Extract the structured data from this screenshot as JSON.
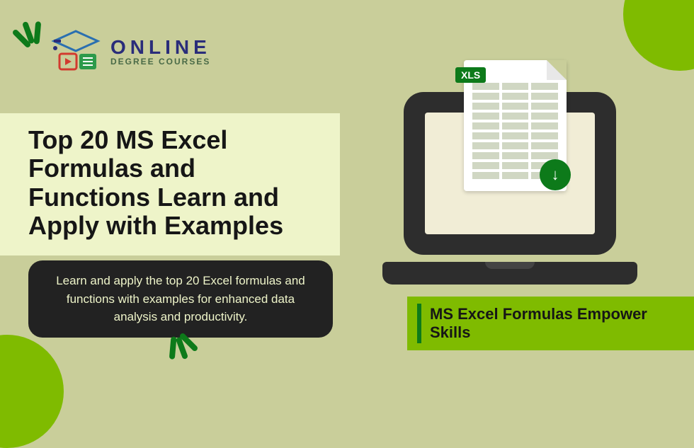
{
  "logo": {
    "main": "ONLINE",
    "sub": "DEGREE COURSES"
  },
  "title": "Top 20 MS Excel Formulas and Functions Learn and Apply with Examples",
  "description": "Learn and apply the top 20 Excel formulas and functions with examples for enhanced data analysis and productivity.",
  "xls_label": "XLS",
  "download_glyph": "↓",
  "caption": "MS Excel Formulas Empower Skills"
}
